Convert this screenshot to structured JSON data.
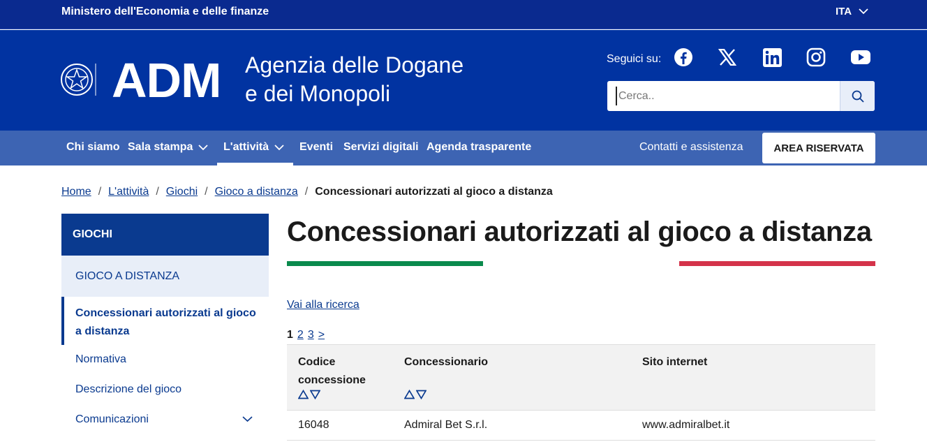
{
  "topbar": {
    "ministry": "Ministero dell'Economia e delle finanze",
    "lang": "ITA"
  },
  "header": {
    "logo_text": "ADM",
    "agency_line1": "Agenzia delle Dogane",
    "agency_line2": "e dei Monopoli",
    "follow_label": "Seguici su:",
    "social": [
      "facebook-icon",
      "x-icon",
      "linkedin-icon",
      "instagram-icon",
      "youtube-icon"
    ],
    "search_placeholder": "Cerca.."
  },
  "nav": {
    "items": [
      "Chi siamo",
      "Sala stampa",
      "L'attività",
      "Eventi",
      "Servizi digitali",
      "Agenda trasparente"
    ],
    "contatti": "Contatti e assistenza",
    "area": "AREA RISERVATA"
  },
  "breadcrumb": [
    "Home",
    "L'attività",
    "Giochi",
    "Gioco a distanza",
    "Concessionari autorizzati al gioco a distanza"
  ],
  "sidebar": {
    "head": "GIOCHI",
    "sub": "GIOCO A DISTANZA",
    "active": "Concessionari autorizzati al gioco a distanza",
    "links": [
      "Normativa",
      "Descrizione del gioco",
      "Comunicazioni"
    ]
  },
  "main": {
    "title": "Concessionari autorizzati al gioco a distanza",
    "vai": "Vai alla ricerca",
    "pages": [
      "1",
      "2",
      "3",
      ">"
    ],
    "table": {
      "headers": [
        "Codice concessione",
        "Concessionario",
        "Sito internet"
      ],
      "rows": [
        [
          "16048",
          "Admiral Bet S.r.l.",
          "www.admiralbet.it"
        ]
      ]
    }
  },
  "colors": {
    "top": "#0a2a8f",
    "header": "#0133a1",
    "nav": "#3d64b3",
    "green": "#0a8a4d",
    "red": "#d4334a"
  }
}
